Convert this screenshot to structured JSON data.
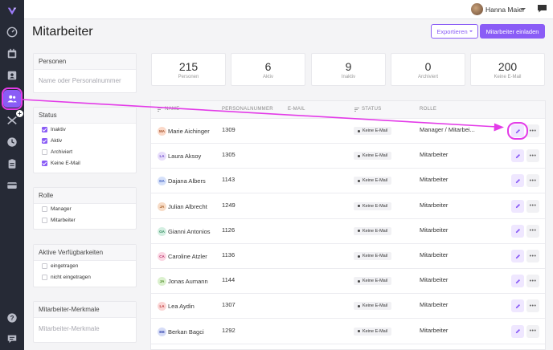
{
  "colors": {
    "accent": "#8a5cf6",
    "annotation": "#e33be8",
    "sidebar": "#262a36"
  },
  "sidebar": {
    "items": [
      {
        "icon": "logo-icon"
      },
      {
        "icon": "dashboard-icon"
      },
      {
        "icon": "calendar-icon"
      },
      {
        "icon": "contact-card-icon"
      },
      {
        "icon": "users-icon",
        "active": true
      },
      {
        "icon": "plane-icon"
      },
      {
        "icon": "clock-icon"
      },
      {
        "icon": "clipboard-icon"
      },
      {
        "icon": "payment-card-icon"
      },
      {
        "icon": "help-icon"
      },
      {
        "icon": "chat-icon"
      }
    ],
    "plus": "+"
  },
  "topbar": {
    "user_name": "Hanna Maier"
  },
  "header": {
    "title": "Mitarbeiter",
    "export_label": "Exportieren",
    "invite_label": "Mitarbeiter einladen"
  },
  "filters": {
    "personen": {
      "title": "Personen",
      "placeholder": "Name oder Personalnummer"
    },
    "status": {
      "title": "Status",
      "options": [
        {
          "label": "Inaktiv",
          "checked": true
        },
        {
          "label": "Aktiv",
          "checked": true
        },
        {
          "label": "Archiviert",
          "checked": false
        },
        {
          "label": "Keine E-Mail",
          "checked": true
        }
      ]
    },
    "rolle": {
      "title": "Rolle",
      "options": [
        {
          "label": "Manager",
          "checked": false
        },
        {
          "label": "Mitarbeiter",
          "checked": false
        }
      ]
    },
    "verfuegbarkeiten": {
      "title": "Aktive Verfügbarkeiten",
      "options": [
        {
          "label": "eingetragen",
          "checked": false
        },
        {
          "label": "nicht eingetragen",
          "checked": false
        }
      ]
    },
    "merkmale": {
      "title": "Mitarbeiter-Merkmale",
      "placeholder": "Mitarbeiter-Merkmale"
    }
  },
  "stats": [
    {
      "value": "215",
      "label": "Personen"
    },
    {
      "value": "6",
      "label": "Aktiv"
    },
    {
      "value": "9",
      "label": "Inaktiv"
    },
    {
      "value": "0",
      "label": "Archiviert"
    },
    {
      "value": "200",
      "label": "Keine E-Mail"
    }
  ],
  "table": {
    "columns": {
      "name": "NAME",
      "personalnummer": "PERSONALNUMMER",
      "email": "E-MAIL",
      "status": "STATUS",
      "rolle": "ROLLE"
    },
    "rows": [
      {
        "initials": "MA",
        "name": "Marie Aichinger",
        "nr": "1309",
        "status": "Keine E-Mail",
        "role": "Manager / Mitarbei...",
        "ava_bg": "#fbd9c9",
        "ava_fg": "#a5522b"
      },
      {
        "initials": "LA",
        "name": "Laura Aksoy",
        "nr": "1305",
        "status": "Keine E-Mail",
        "role": "Mitarbeiter",
        "ava_bg": "#e7ddfb",
        "ava_fg": "#6c47c9"
      },
      {
        "initials": "DA",
        "name": "Dajana Albers",
        "nr": "1143",
        "status": "Keine E-Mail",
        "role": "Mitarbeiter",
        "ava_bg": "#d6e1fa",
        "ava_fg": "#3b5bbf"
      },
      {
        "initials": "JA",
        "name": "Julian Albrecht",
        "nr": "1249",
        "status": "Keine E-Mail",
        "role": "Mitarbeiter",
        "ava_bg": "#f7dcc7",
        "ava_fg": "#a55a20"
      },
      {
        "initials": "GA",
        "name": "Gianni Antonios",
        "nr": "1126",
        "status": "Keine E-Mail",
        "role": "Mitarbeiter",
        "ava_bg": "#d4efe2",
        "ava_fg": "#2f8a5c"
      },
      {
        "initials": "CA",
        "name": "Caroline Atzler",
        "nr": "1136",
        "status": "Keine E-Mail",
        "role": "Mitarbeiter",
        "ava_bg": "#fbd6e3",
        "ava_fg": "#b8336a"
      },
      {
        "initials": "JA",
        "name": "Jonas Aumann",
        "nr": "1144",
        "status": "Keine E-Mail",
        "role": "Mitarbeiter",
        "ava_bg": "#dcf1cf",
        "ava_fg": "#4a8a22"
      },
      {
        "initials": "LA",
        "name": "Lea Aydin",
        "nr": "1307",
        "status": "Keine E-Mail",
        "role": "Mitarbeiter",
        "ava_bg": "#fbd5d5",
        "ava_fg": "#b83333"
      },
      {
        "initials": "BB",
        "name": "Berkan Bagci",
        "nr": "1292",
        "status": "Keine E-Mail",
        "role": "Mitarbeiter",
        "ava_bg": "#d6dcf7",
        "ava_fg": "#3b4bb0"
      }
    ]
  }
}
